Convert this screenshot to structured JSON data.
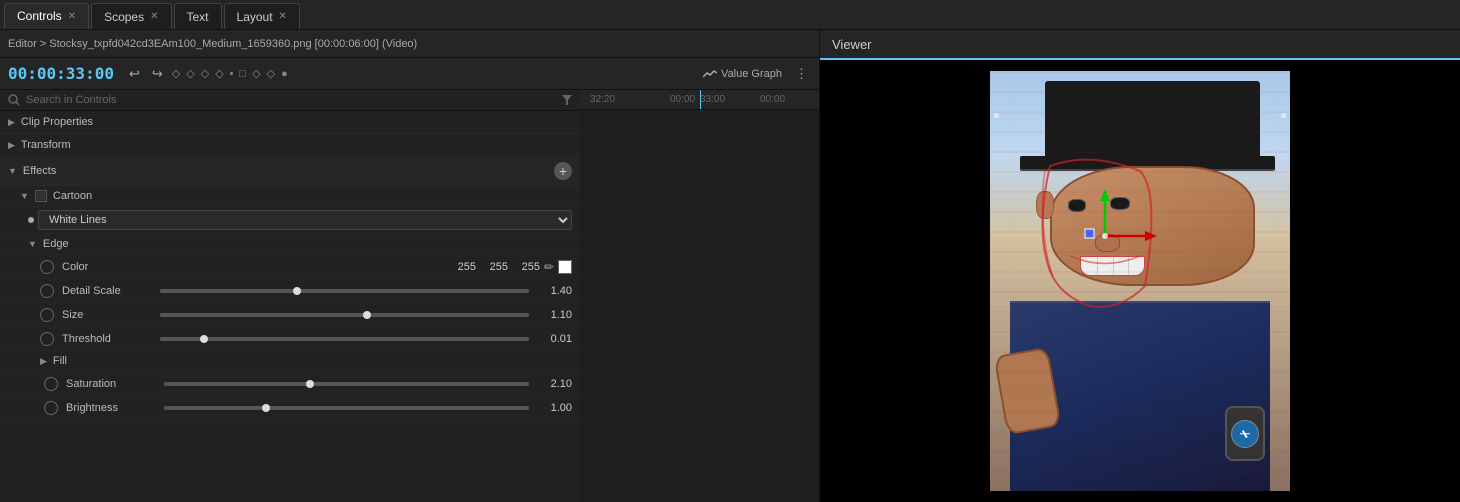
{
  "tabs": [
    {
      "label": "Controls",
      "active": true,
      "closable": true
    },
    {
      "label": "Scopes",
      "active": false,
      "closable": true
    },
    {
      "label": "Text",
      "active": false,
      "closable": false
    },
    {
      "label": "Layout",
      "active": false,
      "closable": true
    }
  ],
  "editor": {
    "breadcrumb": "Editor > Stocksy_txpfd042cd3EAm100_Medium_1659360.png [00:00:06:00] (Video)",
    "timecode": "00:00:33:00"
  },
  "toolbar": {
    "value_graph_label": "Value Graph"
  },
  "search": {
    "placeholder": "Search in Controls"
  },
  "sections": {
    "clip_properties": "Clip Properties",
    "transform": "Transform",
    "effects": "Effects",
    "cartoon": "Cartoon",
    "edge": "Edge",
    "fill": "Fill"
  },
  "dropdown": {
    "selected": "White Lines"
  },
  "properties": {
    "color": {
      "label": "Color",
      "r": "255",
      "g": "255",
      "b": "255"
    },
    "detail_scale": {
      "label": "Detail Scale",
      "value": "1.40",
      "thumb_pct": 37
    },
    "size": {
      "label": "Size",
      "value": "1.10",
      "thumb_pct": 56
    },
    "threshold": {
      "label": "Threshold",
      "value": "0.01",
      "thumb_pct": 12
    },
    "saturation": {
      "label": "Saturation",
      "value": "2.10",
      "thumb_pct": 40
    },
    "brightness": {
      "label": "Brightness",
      "value": "1.00",
      "thumb_pct": 28
    }
  },
  "timeline": {
    "ticks": [
      "32:20",
      "00:00",
      "33:00",
      "00:00"
    ]
  },
  "viewer": {
    "label": "Viewer"
  },
  "colors": {
    "accent": "#5bc8f5",
    "active_border": "#4a9aba"
  }
}
